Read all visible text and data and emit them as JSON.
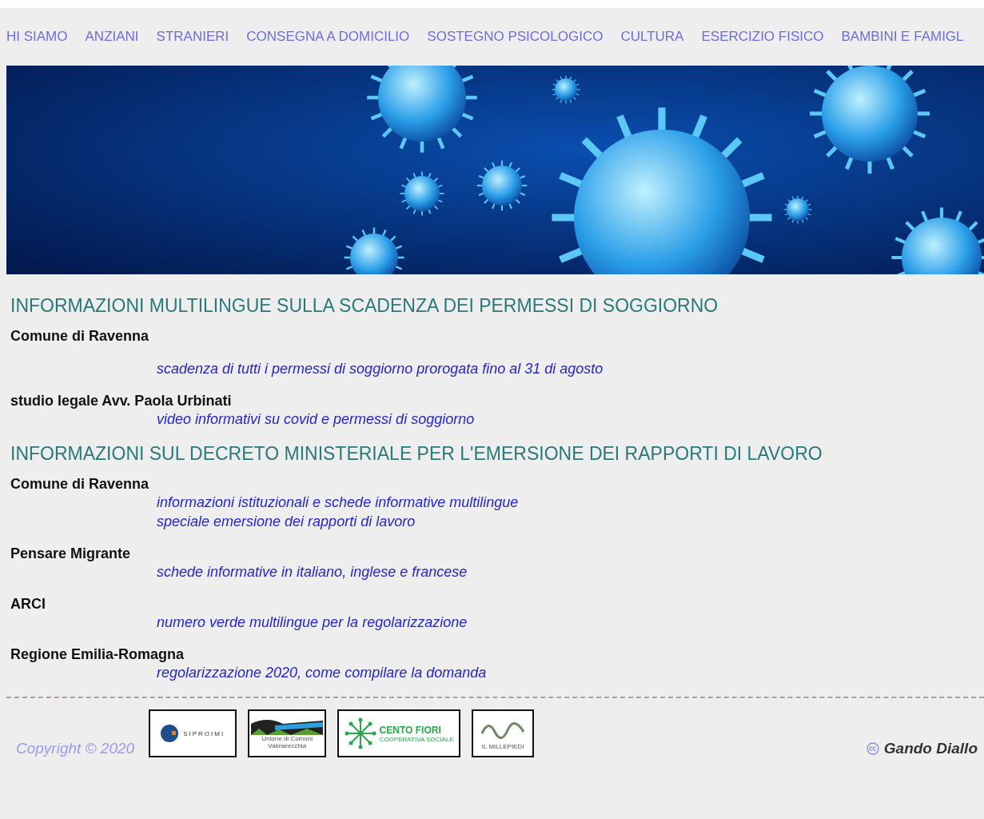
{
  "nav": [
    {
      "label": "HI SIAMO"
    },
    {
      "label": "ANZIANI"
    },
    {
      "label": "STRANIERI"
    },
    {
      "label": "CONSEGNA A DOMICILIO"
    },
    {
      "label": "SOSTEGNO PSICOLOGICO"
    },
    {
      "label": "CULTURA"
    },
    {
      "label": "ESERCIZIO FISICO"
    },
    {
      "label": "BAMBINI E FAMIGL"
    }
  ],
  "sections": [
    {
      "title": "INFORMAZIONI MULTILINGUE SULLA SCADENZA DEI PERMESSI DI SOGGIORNO",
      "entries": [
        {
          "source": "Comune di Ravenna",
          "gap": true,
          "links": [
            "scadenza di tutti i permessi di soggiorno prorogata fino al 31 di agosto"
          ]
        },
        {
          "source": "studio legale Avv. Paola Urbinati",
          "gap": false,
          "links": [
            "video informativi su covid e permessi di soggiorno"
          ]
        }
      ]
    },
    {
      "title": "INFORMAZIONI SUL DECRETO MINISTERIALE PER L'EMERSIONE DEI RAPPORTI DI LAVORO",
      "entries": [
        {
          "source": "Comune di Ravenna",
          "gap": false,
          "links": [
            "informazioni istituzionali e schede informative multilingue",
            "speciale emersione dei rapporti di lavoro"
          ]
        },
        {
          "source": "Pensare Migrante",
          "gap": false,
          "links": [
            "schede informative in italiano, inglese e francese"
          ]
        },
        {
          "source": "ARCI",
          "gap": false,
          "links": [
            "numero verde multilingue per la regolarizzazione"
          ]
        },
        {
          "source": "Regione Emilia-Romagna",
          "gap": false,
          "links": [
            "regolarizzazione 2020, come compilare la domanda"
          ]
        }
      ]
    }
  ],
  "footer": {
    "copyright": "Copyright © 2020",
    "logos": [
      {
        "kind": "siproimi",
        "texts": [
          "SIPROIMI"
        ]
      },
      {
        "kind": "valmarecchia",
        "texts": [
          "Unione di Comuni",
          "Valmarecchia"
        ]
      },
      {
        "kind": "centofiori",
        "texts": [
          "CENTO FIORI",
          "COOPERATIVA SOCIALE"
        ]
      },
      {
        "kind": "millepiedi",
        "texts": [
          "IL MILLEPIEDI"
        ]
      }
    ],
    "author": "Gando Diallo"
  }
}
